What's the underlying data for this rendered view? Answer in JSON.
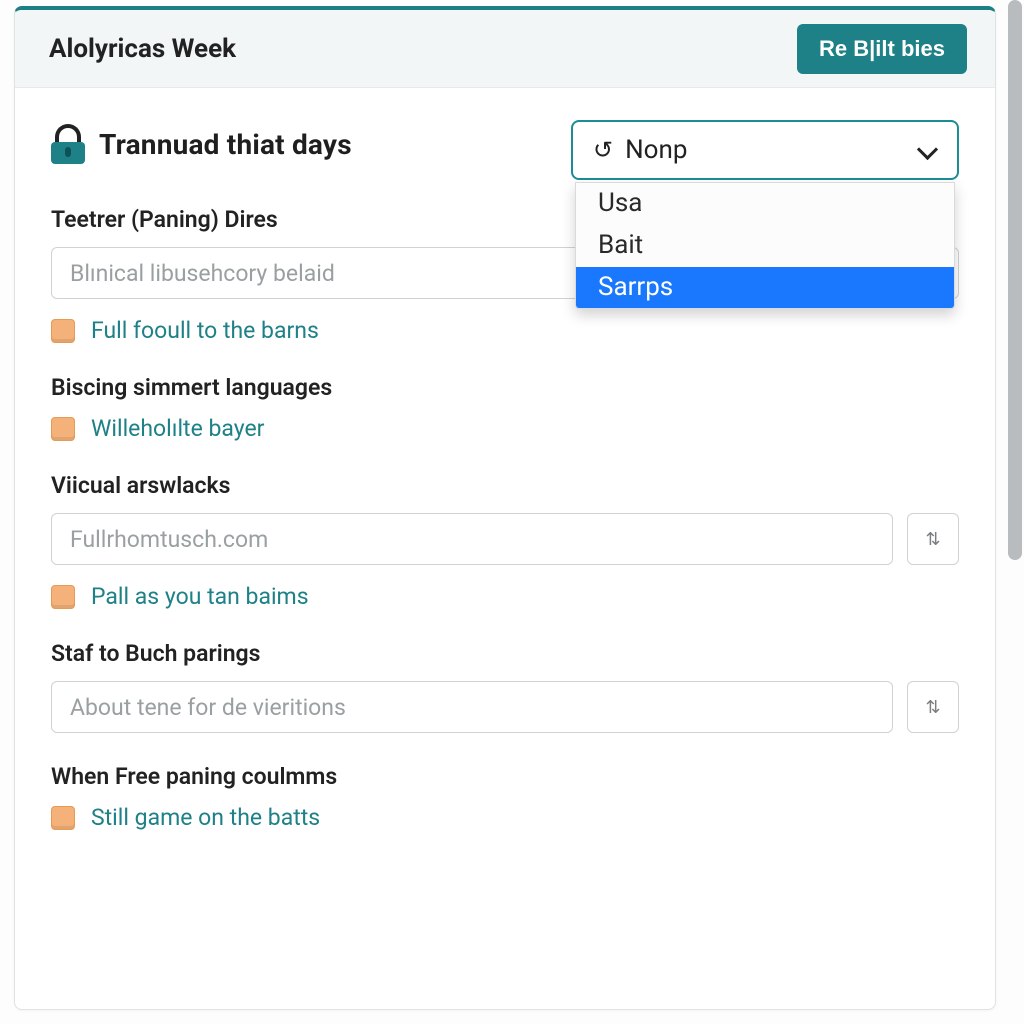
{
  "header": {
    "title": "Alolyricas Week",
    "action_label": "Re B|ilt bies"
  },
  "section": {
    "title": "Trannuad thiat days"
  },
  "select": {
    "value": "Nonp",
    "options": [
      "Usa",
      "Bait",
      "Sarrps"
    ],
    "highlighted_index": 2
  },
  "fields": [
    {
      "label": "Teetrer (Paning) Dires",
      "placeholder": "Blınical libusehcory belaid",
      "has_aux": false,
      "checkbox_label": "Full fooull to the barns"
    },
    {
      "label": "Biscing simmert languages",
      "placeholder": null,
      "has_aux": false,
      "checkbox_label": "Willeholılte bayer"
    },
    {
      "label": "Viicual arswlacks",
      "placeholder": "Fullrhomtusch.com",
      "has_aux": true,
      "checkbox_label": "Pall as you tan baims"
    },
    {
      "label": "Staf to Buch parings",
      "placeholder": "About tene for de vieritions",
      "has_aux": true,
      "checkbox_label": null
    },
    {
      "label": "When Free paning coulmms",
      "placeholder": null,
      "has_aux": false,
      "checkbox_label": "Still game on the batts"
    }
  ],
  "icons": {
    "aux": "⇅"
  },
  "colors": {
    "accent": "#1e8187",
    "highlight": "#1a78ff",
    "checkbox": "#f4b27a"
  }
}
